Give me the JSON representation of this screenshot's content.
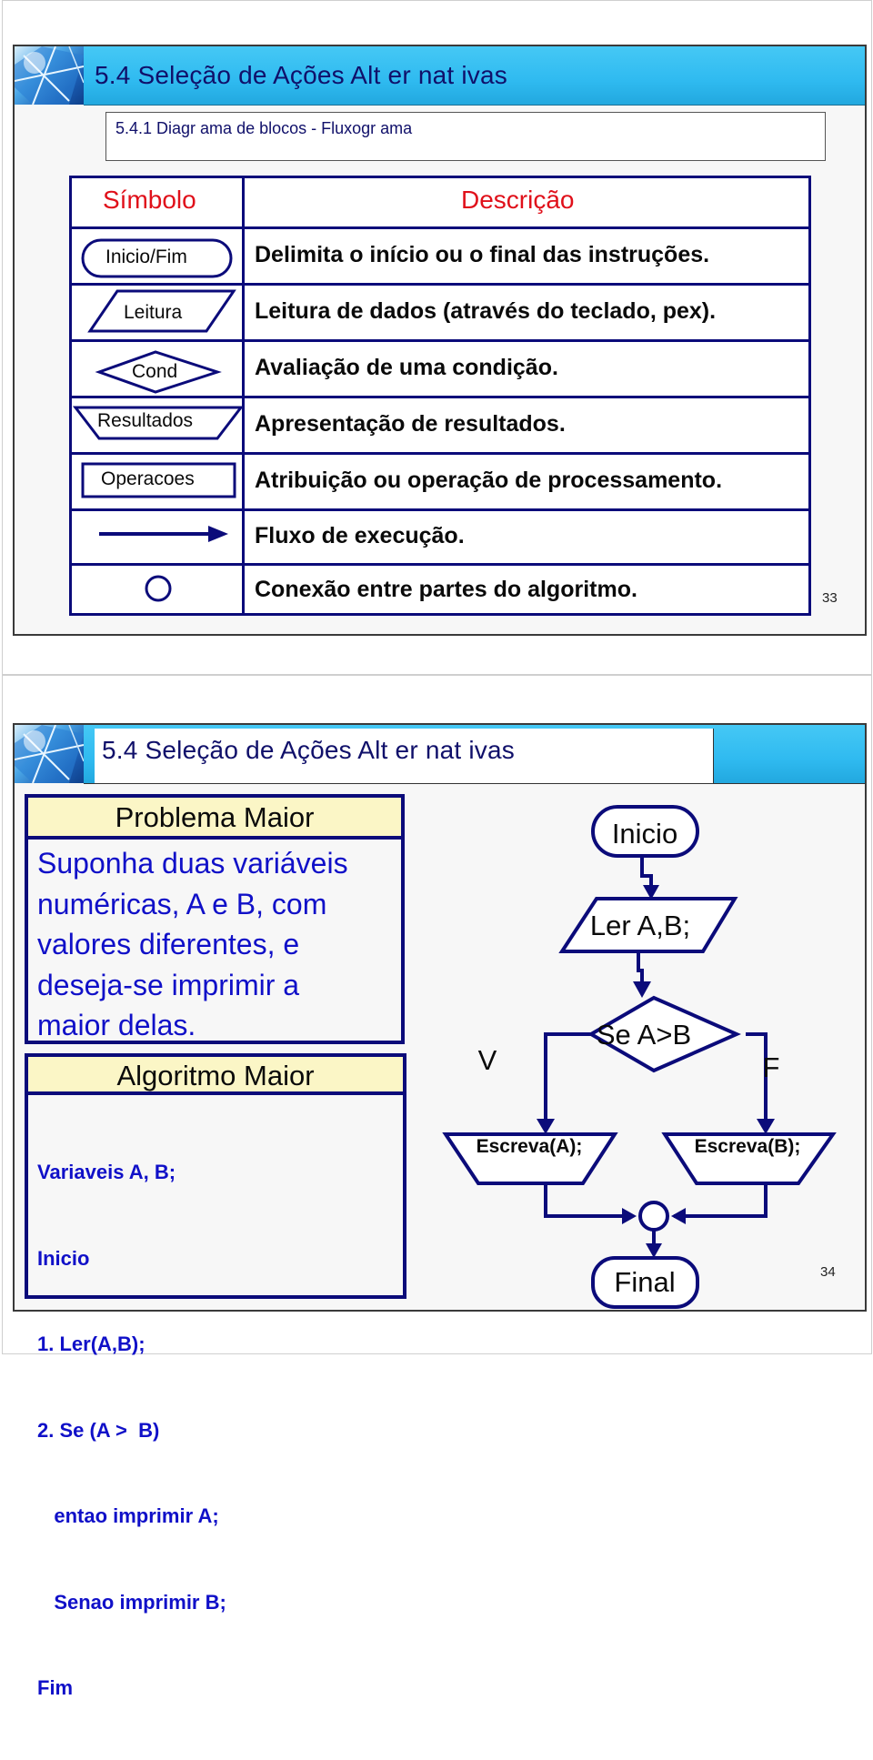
{
  "slide1": {
    "title": "5.4 Seleção de Ações Alt er nat ivas",
    "subtitle": "5.4.1 Diagr ama de blocos - Fluxogr ama",
    "table": {
      "headers": {
        "symbol": "Símbolo",
        "description": "Descrição"
      },
      "rows": [
        {
          "symbol": "Inicio/Fim",
          "shape": "terminator",
          "description": "Delimita o início ou o final das instruções."
        },
        {
          "symbol": "Leitura",
          "shape": "parallelogram",
          "description": "Leitura de dados (através do teclado, pex)."
        },
        {
          "symbol": "Cond",
          "shape": "diamond",
          "description": "Avaliação de uma condição."
        },
        {
          "symbol": "Resultados",
          "shape": "display-trapezoid",
          "description": "Apresentação de resultados."
        },
        {
          "symbol": "Operacoes",
          "shape": "rectangle",
          "description": "Atribuição ou operação de processamento."
        },
        {
          "symbol": "",
          "shape": "arrow",
          "description": "Fluxo de execução."
        },
        {
          "symbol": "",
          "shape": "circle",
          "description": "Conexão entre partes do algoritmo."
        }
      ]
    },
    "page_number": "33"
  },
  "slide2": {
    "title": "5.4 Seleção de Ações Alt er nat ivas",
    "problem": {
      "heading": "Problema Maior",
      "lines": [
        "Suponha duas variáveis",
        "numéricas, A e B, com",
        "valores diferentes, e",
        "deseja-se imprimir a",
        "maior delas."
      ]
    },
    "algorithm": {
      "heading": "Algoritmo Maior",
      "lines": [
        "Variaveis A, B;",
        "Inicio",
        "1. Ler(A,B);",
        "2. Se (A >  B)",
        "   entao imprimir A;",
        "   Senao imprimir B;",
        "Fim"
      ]
    },
    "flowchart": {
      "start": "Inicio",
      "read": "Ler A,B;",
      "decision": "Se A>B",
      "true_label": "V",
      "false_label": "F",
      "write_a": "Escreva(A);",
      "write_b": "Escreva(B);",
      "end": "Final"
    },
    "page_number": "34"
  },
  "colors": {
    "header_blue": "#2fbaf0",
    "title_navy": "#10106a",
    "outline_navy": "#0b0b7a",
    "heading_red": "#e0101a",
    "body_blue": "#1010c8",
    "box_header_yellow": "#fbf6c6"
  }
}
